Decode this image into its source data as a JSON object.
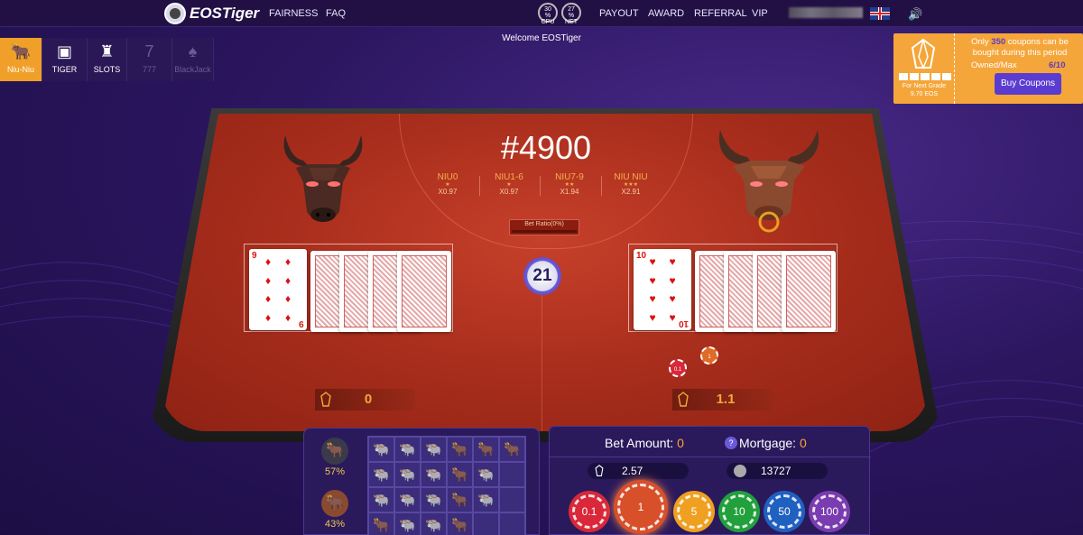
{
  "nav": {
    "brand": "EOSTiger",
    "links": [
      "FAIRNESS",
      "FAQ"
    ],
    "rates": [
      {
        "top": "30",
        "unit": "%",
        "bottom": "CPU"
      },
      {
        "top": "27",
        "unit": "%",
        "bottom": "NET"
      }
    ],
    "right_links": [
      "PAYOUT",
      "AWARD",
      "REFERRAL",
      "VIP"
    ]
  },
  "welcome": "Welcome EOSTiger",
  "game_tabs": [
    {
      "label": "Niu-Niu",
      "icon": "bull-icon",
      "active": true
    },
    {
      "label": "TIGER",
      "icon": "slot-machine-icon"
    },
    {
      "label": "SLOTS",
      "icon": "slots-icon"
    },
    {
      "label": "777",
      "icon": "seven-icon",
      "disabled": true
    },
    {
      "label": "BlackJack",
      "icon": "cards-icon",
      "disabled": true
    }
  ],
  "coupon": {
    "text_pre": "Only ",
    "count": "350",
    "text_post": " coupons can be bought during this period",
    "owned_label": "Owned/Max",
    "owned_value": "6/10",
    "next_grade_label": "For Next Grade",
    "next_grade_value": "9.70 EOS",
    "button": "Buy Coupons"
  },
  "table": {
    "round": "#4900",
    "odds": [
      {
        "name": "NIU0",
        "stars": "★",
        "mult": "X0.97"
      },
      {
        "name": "NIU1-6",
        "stars": "★",
        "mult": "X0.97"
      },
      {
        "name": "NIU7-9",
        "stars": "★★",
        "mult": "X1.94"
      },
      {
        "name": "NIU NIU",
        "stars": "★★★",
        "mult": "X2.91"
      }
    ],
    "bet_ratio": "Bet Ratio(0%)",
    "timer": "21",
    "left_card": {
      "rank": "9",
      "suit": "♦"
    },
    "right_card": {
      "rank": "10",
      "suit": "♥"
    },
    "left_score": "0",
    "right_score": "1.1",
    "table_chips": [
      "0.1",
      "1"
    ]
  },
  "history": {
    "banker_pct": "57%",
    "player_pct": "43%"
  },
  "bet": {
    "amount_label": "Bet Amount:",
    "amount_value": "0",
    "mortgage_label": "Mortgage:",
    "mortgage_value": "0",
    "q": "?",
    "eos_balance": "2.57",
    "token_balance": "13727",
    "chips": [
      {
        "label": "0.1",
        "color": "#d8283a"
      },
      {
        "label": "1",
        "color": "#d8502a"
      },
      {
        "label": "5",
        "color": "#f0a020"
      },
      {
        "label": "10",
        "color": "#22a03c"
      },
      {
        "label": "50",
        "color": "#2060c0"
      },
      {
        "label": "100",
        "color": "#7a3cb0"
      }
    ]
  },
  "colors": {
    "accent": "#f5a63a",
    "felt": "#b8361f",
    "bg": "#2c1660"
  }
}
